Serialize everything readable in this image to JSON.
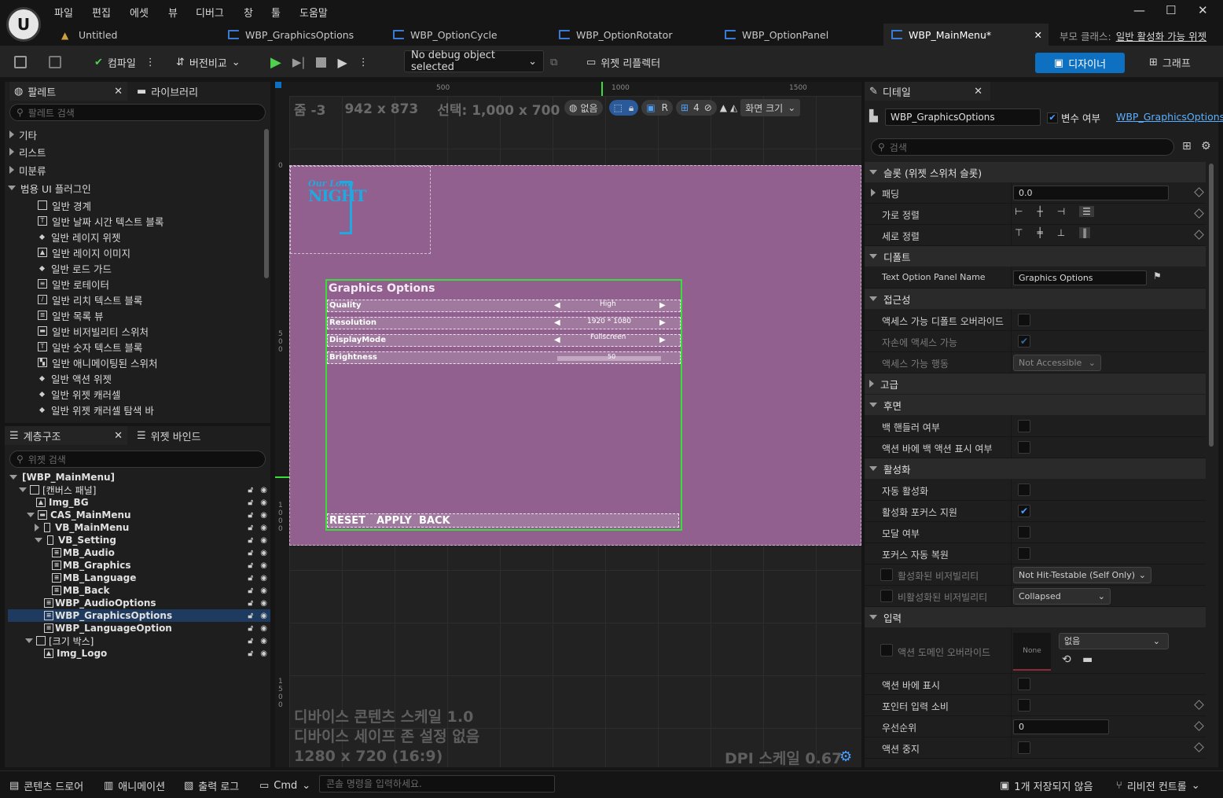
{
  "menu": {
    "items": [
      "파일",
      "편집",
      "에셋",
      "뷰",
      "디버그",
      "창",
      "툴",
      "도움말"
    ]
  },
  "tabs": [
    {
      "label": "Untitled"
    },
    {
      "label": "WBP_GraphicsOptions"
    },
    {
      "label": "WBP_OptionCycle"
    },
    {
      "label": "WBP_OptionRotator"
    },
    {
      "label": "WBP_OptionPanel"
    },
    {
      "label": "WBP_MainMenu*"
    }
  ],
  "parent_class": {
    "label": "부모 클래스:",
    "value": "일반 활성화 가능 위젯"
  },
  "toolbar": {
    "compile": "컴파일",
    "diff": "버전비교",
    "debug_object": "No debug object selected",
    "widget_reflector": "위젯 리플렉터",
    "designer": "디자이너",
    "graph": "그래프"
  },
  "palette": {
    "tab": "팔레트",
    "library_tab": "라이브러리",
    "search_placeholder": "팔레트 검색",
    "categories": [
      "기타",
      "리스트",
      "미분류",
      "범용 UI 플러그인"
    ],
    "items": [
      "일반 경계",
      "일반 날짜 시간 텍스트 블록",
      "일반 레이지 위젯",
      "일반 레이지 이미지",
      "일반 로드 가드",
      "일반 로테이터",
      "일반 리치 텍스트 블록",
      "일반 목록 뷰",
      "일반 비저빌리티 스위처",
      "일반 숫자 텍스트 블록",
      "일반 애니메이팅된 스위처",
      "일반 액션 위젯",
      "일반 위젯 캐러셀",
      "일반 위젯 캐러셀 탐색 바"
    ]
  },
  "hierarchy": {
    "tab": "계층구조",
    "bindings_tab": "위젯 바인드",
    "search_placeholder": "위젯 검색",
    "rows": [
      "[WBP_MainMenu]",
      "[캔버스 패널]",
      "Img_BG",
      "CAS_MainMenu",
      "VB_MainMenu",
      "VB_Setting",
      "MB_Audio",
      "MB_Graphics",
      "MB_Language",
      "MB_Back",
      "WBP_AudioOptions",
      "WBP_GraphicsOptions",
      "WBP_LanguageOption",
      "[크기 박스]",
      "Img_Logo"
    ]
  },
  "designer": {
    "zoom": "줌 -3",
    "size": "942 x 873",
    "selection": "선택: 1,000 x 700",
    "none_label": "없음",
    "grid_snap": "4",
    "screen_size": "화면 크기",
    "ruler_top": [
      "500",
      "1000",
      "1500"
    ],
    "ruler_left": [
      "0",
      "500",
      "1000",
      "1500"
    ],
    "device_scale": "디바이스 콘텐츠 스케일 1.0",
    "safe_zone": "디바이스 세이프 존 설정 없음",
    "resolution": "1280 x 720 (16:9)",
    "dpi": "DPI 스케일 0.67",
    "logo_text": [
      "Our Long",
      "NIGHT"
    ],
    "panel_title": "Graphics Options",
    "options": [
      {
        "label": "Quality",
        "value": "High"
      },
      {
        "label": "Resolution",
        "value": "1920 * 1080"
      },
      {
        "label": "DisplayMode",
        "value": "Fullscreen"
      },
      {
        "label": "Brightness",
        "value": "50"
      }
    ],
    "buttons": [
      "RESET",
      "APPLY",
      "BACK"
    ]
  },
  "details": {
    "tab": "디테일",
    "name": "WBP_GraphicsOptions",
    "is_variable": "변수 여부",
    "class_link": "WBP_GraphicsOptions",
    "search_placeholder": "검색",
    "slot_section": "슬롯 (위젯 스위처 슬롯)",
    "padding_label": "패딩",
    "padding_value": "0.0",
    "h_align": "가로 정렬",
    "v_align": "세로 정렬",
    "default_section": "디폴트",
    "text_option_label": "Text Option Panel Name",
    "text_option_value": "Graphics Options",
    "access_section": "접근성",
    "access_override": "액세스 가능 디폴트 오버라이드",
    "children_access": "자손에 액세스 가능",
    "access_behavior": "액세스 가능 행동",
    "access_behavior_value": "Not Accessible",
    "advanced_section": "고급",
    "back_section": "후면",
    "back_handler": "백 핸들러 여부",
    "back_action": "액션 바에 백 액션 표시 여부",
    "activation_section": "활성화",
    "auto_activate": "자동 활성화",
    "focus_support": "활성화 포커스 지원",
    "modal": "모달 여부",
    "focus_restore": "포커스 자동 복원",
    "activated_vis": "활성화된 비저빌리티",
    "activated_vis_value": "Not Hit-Testable (Self Only)",
    "deactivated_vis": "비활성화된 비저빌리티",
    "deactivated_vis_value": "Collapsed",
    "input_section": "입력",
    "action_domain": "액션 도메인 오버라이드",
    "none_thumb": "None",
    "none_select": "없음",
    "show_action_bar": "액션 바에 표시",
    "consume_pointer": "포인터 입력 소비",
    "priority": "우선순위",
    "priority_value": "0",
    "action_stop": "액션 중지"
  },
  "status": {
    "content_drawer": "콘텐츠 드로어",
    "animation": "애니메이션",
    "output_log": "출력 로그",
    "cmd": "Cmd",
    "console_placeholder": "콘솔 명령을 입력하세요.",
    "unsaved": "1개 저장되지 않음",
    "revision": "리비전 컨트롤"
  },
  "colors": {
    "accent": "#0e70c0",
    "canvas_bg": "#91608e",
    "selection_green": "#3ddc3d",
    "logo_blue": "#1fa9e0"
  }
}
